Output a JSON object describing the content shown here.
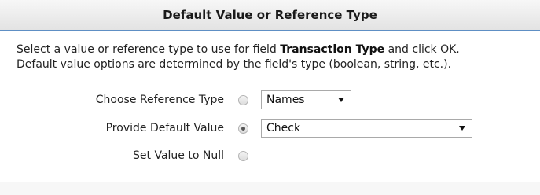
{
  "dialog": {
    "title": "Default Value or Reference Type",
    "intro_before": "Select a value or reference type to use for field ",
    "intro_field": "Transaction Type",
    "intro_after": " and click OK.",
    "intro_line2": "Default value options are determined by the field's type (boolean, string, etc.)."
  },
  "options": {
    "reference": {
      "label": "Choose Reference Type",
      "selected": false,
      "select_value": "Names"
    },
    "default_value": {
      "label": "Provide Default Value",
      "selected": true,
      "select_value": "Check"
    },
    "null_value": {
      "label": "Set Value to Null",
      "selected": false
    }
  },
  "icons": {
    "dropdown": "chevron-down-icon"
  },
  "colors": {
    "title_border": "#5e8fc4"
  }
}
